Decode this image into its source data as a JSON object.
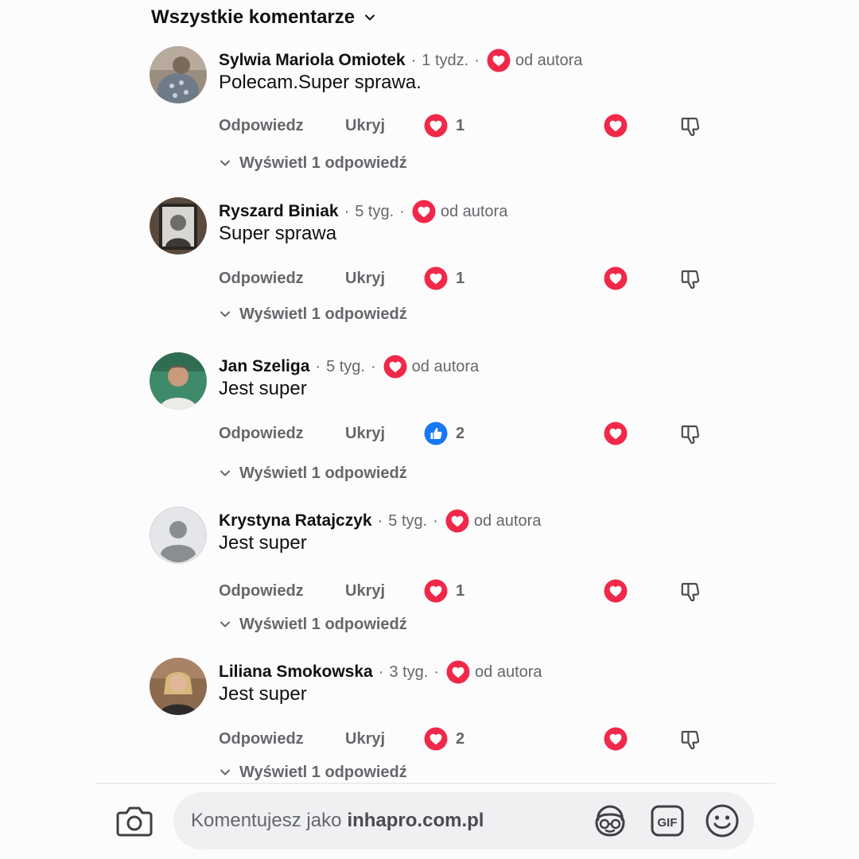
{
  "header": {
    "title": "Wszystkie komentarze",
    "icon": "chevron-down-icon"
  },
  "comments": [
    {
      "author": "Sylwia Mariola Omiotek",
      "time": "1 tydz.",
      "by_author": "od autora",
      "text": "Polecam.Super sprawa.",
      "reaction_type": "love",
      "reaction_count": "1",
      "reply": "Odpowiedz",
      "hide": "Ukryj",
      "view_replies": "Wyświetl 1 odpowiedź"
    },
    {
      "author": "Ryszard Biniak",
      "time": "5 tyg.",
      "by_author": "od autora",
      "text": "Super sprawa",
      "reaction_type": "love",
      "reaction_count": "1",
      "reply": "Odpowiedz",
      "hide": "Ukryj",
      "view_replies": "Wyświetl 1 odpowiedź"
    },
    {
      "author": "Jan Szeliga",
      "time": "5 tyg.",
      "by_author": "od autora",
      "text": "Jest super",
      "reaction_type": "like",
      "reaction_count": "2",
      "reply": "Odpowiedz",
      "hide": "Ukryj",
      "view_replies": "Wyświetl 1 odpowiedź"
    },
    {
      "author": "Krystyna Ratajczyk",
      "time": "5 tyg.",
      "by_author": "od autora",
      "text": "Jest super",
      "reaction_type": "love",
      "reaction_count": "1",
      "reply": "Odpowiedz",
      "hide": "Ukryj",
      "view_replies": "Wyświetl 1 odpowiedź"
    },
    {
      "author": "Liliana Smokowska",
      "time": "3 tyg.",
      "by_author": "od autora",
      "text": "Jest super",
      "reaction_type": "love",
      "reaction_count": "2",
      "reply": "Odpowiedz",
      "hide": "Ukryj",
      "view_replies": "Wyświetl 1 odpowiedź"
    }
  ],
  "composer": {
    "placeholder_prefix": "Komentujesz jako",
    "placeholder_account": "inhapro.com.pl",
    "buttons": [
      "camera-icon",
      "avatar-sticker-icon",
      "gif-icon",
      "emoji-icon"
    ],
    "gif_label": "GIF"
  },
  "colors": {
    "love": "#f02849",
    "like": "#1877f2",
    "muted_text": "#65676b",
    "input_bg": "#eef0f2"
  }
}
